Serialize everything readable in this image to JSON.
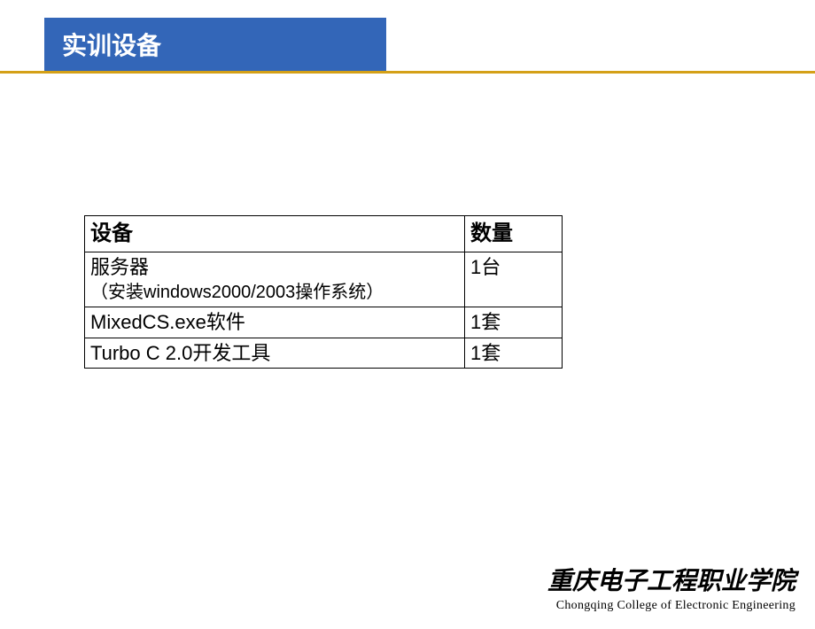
{
  "header": {
    "title": "实训设备"
  },
  "table": {
    "headers": {
      "equipment": "设备",
      "quantity": "数量"
    },
    "rows": [
      {
        "equipment_line1": "服务器",
        "equipment_line2": "（安装windows2000/2003操作系统）",
        "quantity": "1台"
      },
      {
        "equipment_line1": "MixedCS.exe软件",
        "equipment_line2": "",
        "quantity": "1套"
      },
      {
        "equipment_line1": "Turbo C 2.0开发工具",
        "equipment_line2": "",
        "quantity": "1套"
      }
    ]
  },
  "footer": {
    "logo_cn": "重庆电子工程职业学院",
    "logo_en": "Chongqing College of Electronic Engineering"
  }
}
